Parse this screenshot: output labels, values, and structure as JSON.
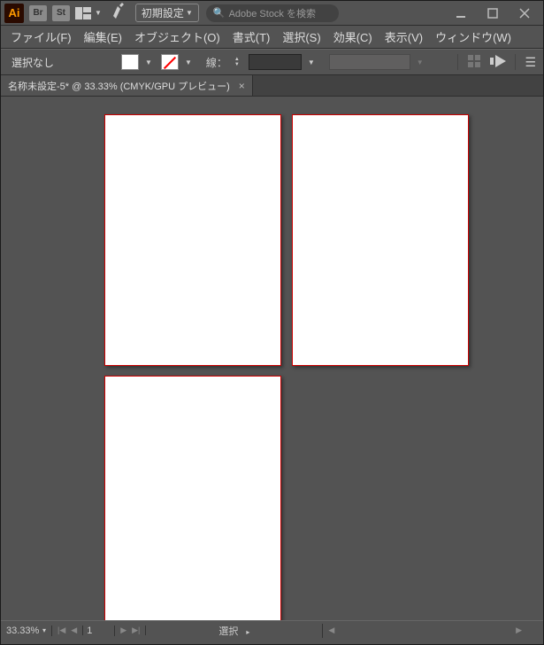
{
  "titlebar": {
    "logo_text": "Ai",
    "br_icon": "Br",
    "st_icon": "St",
    "workspace_label": "初期設定",
    "search_placeholder": "Adobe Stock を検索"
  },
  "menu": {
    "items": [
      "ファイル(F)",
      "編集(E)",
      "オブジェクト(O)",
      "書式(T)",
      "選択(S)",
      "効果(C)",
      "表示(V)",
      "ウィンドウ(W)"
    ]
  },
  "controlbar": {
    "selection_label": "選択なし",
    "stroke_label": "線："
  },
  "tab": {
    "title": "名称未設定-5* @ 33.33% (CMYK/GPU プレビュー)"
  },
  "status": {
    "zoom": "33.33%",
    "artboard_index": "1",
    "tool": "選択"
  }
}
